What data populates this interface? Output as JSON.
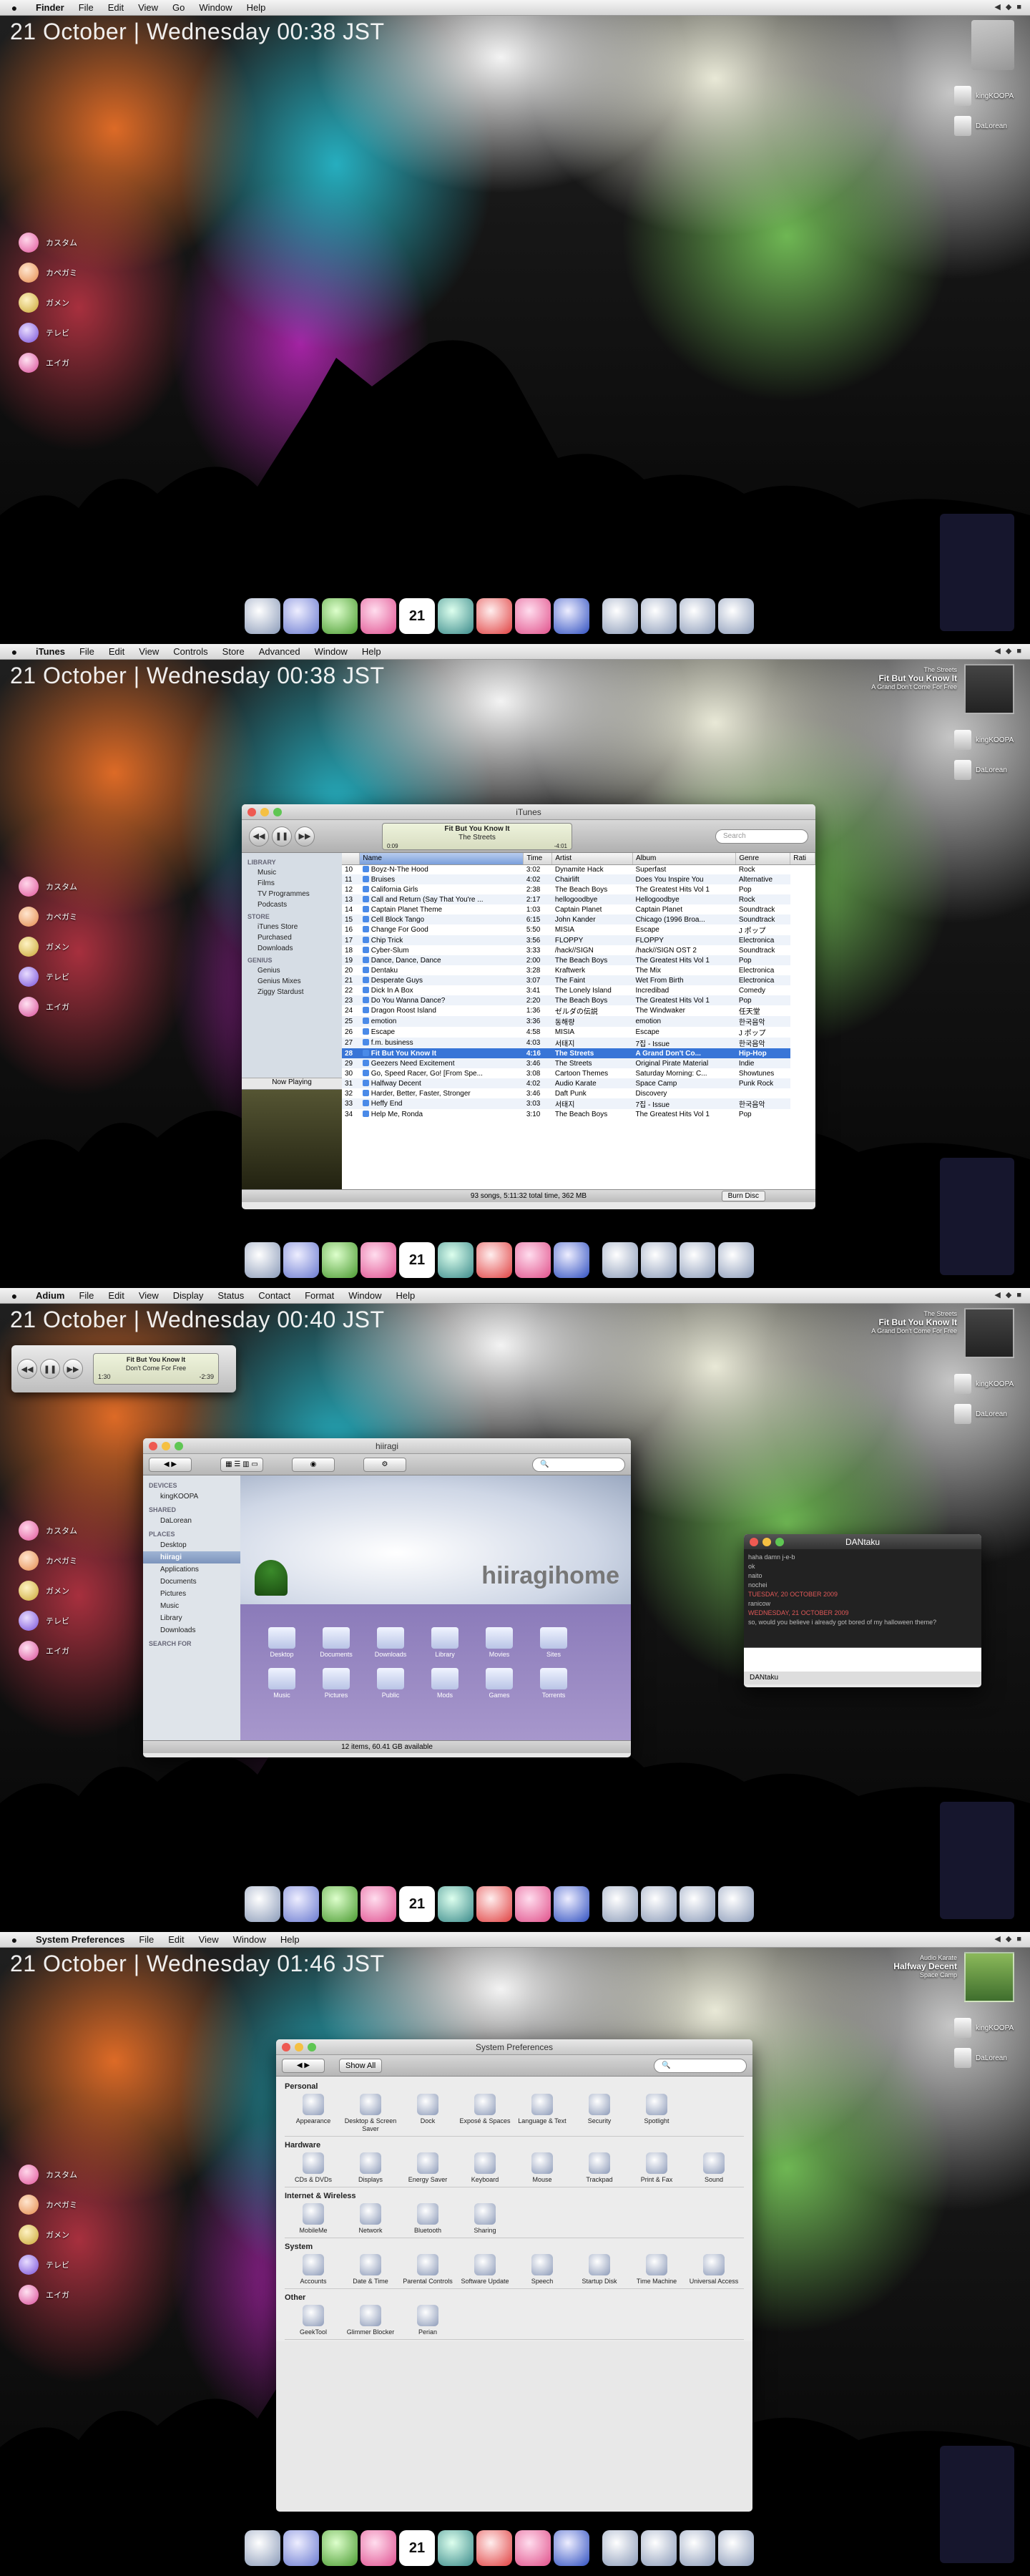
{
  "panels": [
    {
      "app": "Finder",
      "menu": [
        "File",
        "Edit",
        "View",
        "Go",
        "Window",
        "Help"
      ],
      "clock": "21 October | Wednesday  00:38 JST"
    },
    {
      "app": "iTunes",
      "menu": [
        "File",
        "Edit",
        "View",
        "Controls",
        "Store",
        "Advanced",
        "Window",
        "Help"
      ],
      "clock": "21 October | Wednesday  00:38 JST"
    },
    {
      "app": "Adium",
      "menu": [
        "File",
        "Edit",
        "View",
        "Display",
        "Status",
        "Contact",
        "Format",
        "Window",
        "Help"
      ],
      "clock": "21 October | Wednesday  00:40 JST"
    },
    {
      "app": "System Preferences",
      "menu": [
        "File",
        "Edit",
        "View",
        "Window",
        "Help"
      ],
      "clock": "21 October | Wednesday  01:46 JST"
    }
  ],
  "desktop_left": [
    "カスタム",
    "カペガミ",
    "ガメン",
    "テレビ",
    "エイガ"
  ],
  "drives": [
    "kingKOOPA",
    "DaLorean"
  ],
  "dock_calendar": "21",
  "now_playing_1": {
    "artist": "The Streets",
    "title": "Fit But You Know It",
    "album": "A Grand Don't Come For Free"
  },
  "now_playing_2": {
    "artist": "Audio Karate",
    "title": "Halfway Decent",
    "album": "Space Camp"
  },
  "itunes": {
    "title": "iTunes",
    "lcd_title": "Fit But You Know It",
    "lcd_artist": "The Streets",
    "lcd_elapsed": "0:09",
    "lcd_remaining": "-4:01",
    "lcd_progress": 0.04,
    "search_placeholder": "Search",
    "sidebar": {
      "library_header": "LIBRARY",
      "library": [
        "Music",
        "Films",
        "TV Programmes",
        "Podcasts"
      ],
      "store_header": "STORE",
      "store": [
        "iTunes Store",
        "Purchased",
        "Downloads"
      ],
      "genius_header": "GENIUS",
      "genius": [
        "Genius",
        "Genius Mixes",
        "Ziggy Stardust"
      ],
      "now_playing": "Now Playing"
    },
    "columns": [
      "",
      "Name",
      "Time",
      "Artist",
      "Album",
      "Genre",
      "Rati"
    ],
    "rows": [
      [
        "10",
        "Boyz-N-The Hood",
        "3:02",
        "Dynamite Hack",
        "Superfast",
        "Rock"
      ],
      [
        "11",
        "Bruises",
        "4:02",
        "Chairlift",
        "Does You Inspire You",
        "Alternative"
      ],
      [
        "12",
        "California Girls",
        "2:38",
        "The Beach Boys",
        "The Greatest Hits Vol 1",
        "Pop"
      ],
      [
        "13",
        "Call and Return (Say That You're ...",
        "2:17",
        "hellogoodbye",
        "Hellogoodbye",
        "Rock"
      ],
      [
        "14",
        "Captain Planet Theme",
        "1:03",
        "Captain Planet",
        "Captain Planet",
        "Soundtrack"
      ],
      [
        "15",
        "Cell Block Tango",
        "6:15",
        "John Kander",
        "Chicago (1996 Broa...",
        "Soundtrack"
      ],
      [
        "16",
        "Change For Good",
        "5:50",
        "MISIA",
        "Escape",
        "J ポップ"
      ],
      [
        "17",
        "Chip Trick",
        "3:56",
        "FLOPPY",
        "FLOPPY",
        "Electronica"
      ],
      [
        "18",
        "Cyber-Slum",
        "3:33",
        "/hack//SIGN",
        "/hack//SIGN OST 2",
        "Soundtrack"
      ],
      [
        "19",
        "Dance, Dance, Dance",
        "2:00",
        "The Beach Boys",
        "The Greatest Hits Vol 1",
        "Pop"
      ],
      [
        "20",
        "Dentaku",
        "3:28",
        "Kraftwerk",
        "The Mix",
        "Electronica"
      ],
      [
        "21",
        "Desperate Guys",
        "3:07",
        "The Faint",
        "Wet From Birth",
        "Electronica"
      ],
      [
        "22",
        "Dick In A Box",
        "3:41",
        "The Lonely Island",
        "Incredibad",
        "Comedy"
      ],
      [
        "23",
        "Do You Wanna Dance?",
        "2:20",
        "The Beach Boys",
        "The Greatest Hits Vol 1",
        "Pop"
      ],
      [
        "24",
        "Dragon Roost Island",
        "1:36",
        "ゼルダの伝説",
        "The Windwaker",
        "任天堂"
      ],
      [
        "25",
        "emotion",
        "3:36",
        "동해량",
        "emotion",
        "한국음악"
      ],
      [
        "26",
        "Escape",
        "4:58",
        "MISIA",
        "Escape",
        "J ポップ"
      ],
      [
        "27",
        "f.m. business",
        "4:03",
        "서태지",
        "7집 - Issue",
        "한국음악"
      ],
      [
        "28",
        "Fit But You Know It",
        "4:16",
        "The Streets",
        "A Grand Don't Co...",
        "Hip-Hop"
      ],
      [
        "29",
        "Geezers Need Excitement",
        "3:46",
        "The Streets",
        "Original Pirate Material",
        "Indie"
      ],
      [
        "30",
        "Go, Speed Racer, Go! [From Spe...",
        "3:08",
        "Cartoon Themes",
        "Saturday Morning: C...",
        "Showtunes"
      ],
      [
        "31",
        "Halfway Decent",
        "4:02",
        "Audio Karate",
        "Space Camp",
        "Punk Rock"
      ],
      [
        "32",
        "Harder, Better, Faster, Stronger",
        "3:46",
        "Daft Punk",
        "Discovery",
        ""
      ],
      [
        "33",
        "Heffy End",
        "3:03",
        "서태지",
        "7집 - Issue",
        "한국음악"
      ],
      [
        "34",
        "Help Me, Ronda",
        "3:10",
        "The Beach Boys",
        "The Greatest Hits Vol 1",
        "Pop"
      ]
    ],
    "selected_row": 18,
    "status": "93 songs, 5:11:32 total time, 362 MB",
    "burn_label": "Burn Disc"
  },
  "adium_mini": {
    "title": "Fit But You Know It",
    "subtitle": "Don't Come For Free",
    "elapsed": "1:30",
    "remaining": "-2:39"
  },
  "finder": {
    "title": "hiiragi",
    "devices_header": "DEVICES",
    "devices": [
      "kingKOOPA"
    ],
    "shared_header": "SHARED",
    "shared": [
      "DaLorean"
    ],
    "places_header": "PLACES",
    "places": [
      "Desktop",
      "hiiragi",
      "Applications",
      "Documents",
      "Pictures",
      "Music",
      "Library",
      "Downloads"
    ],
    "search_header": "SEARCH FOR",
    "banner_word": "hiiragihome",
    "items": [
      "Desktop",
      "Documents",
      "Downloads",
      "Library",
      "Movies",
      "Sites",
      "Music",
      "Pictures",
      "Public",
      "Mods",
      "Games",
      "Torrents"
    ],
    "status": "12 items, 60.41 GB available"
  },
  "chat": {
    "title": "DANtaku",
    "lines": [
      {
        "text": "haha damn j-e-b",
        "date": false
      },
      {
        "text": "ok",
        "date": false
      },
      {
        "text": "naito",
        "date": false
      },
      {
        "text": "nochei",
        "date": false
      },
      {
        "text": "TUESDAY, 20 OCTOBER 2009",
        "date": true
      },
      {
        "text": "ranicow",
        "date": false
      },
      {
        "text": "WEDNESDAY, 21 OCTOBER 2009",
        "date": true
      },
      {
        "text": "so, would you believe i already got bored of my halloween theme?",
        "date": false
      }
    ],
    "status": "DANtaku"
  },
  "sysprefs": {
    "title": "System Preferences",
    "show_all": "Show All",
    "sections": [
      {
        "name": "Personal",
        "items": [
          "Appearance",
          "Desktop & Screen Saver",
          "Dock",
          "Exposé & Spaces",
          "Language & Text",
          "Security",
          "Spotlight"
        ]
      },
      {
        "name": "Hardware",
        "items": [
          "CDs & DVDs",
          "Displays",
          "Energy Saver",
          "Keyboard",
          "Mouse",
          "Trackpad",
          "Print & Fax",
          "Sound"
        ]
      },
      {
        "name": "Internet & Wireless",
        "items": [
          "MobileMe",
          "Network",
          "Bluetooth",
          "Sharing"
        ]
      },
      {
        "name": "System",
        "items": [
          "Accounts",
          "Date & Time",
          "Parental Controls",
          "Software Update",
          "Speech",
          "Startup Disk",
          "Time Machine",
          "Universal Access"
        ]
      },
      {
        "name": "Other",
        "items": [
          "GeekTool",
          "Glimmer Blocker",
          "Perian"
        ]
      }
    ]
  },
  "colors": {
    "selection": "#3875d7",
    "chat_date": "#e05858"
  }
}
